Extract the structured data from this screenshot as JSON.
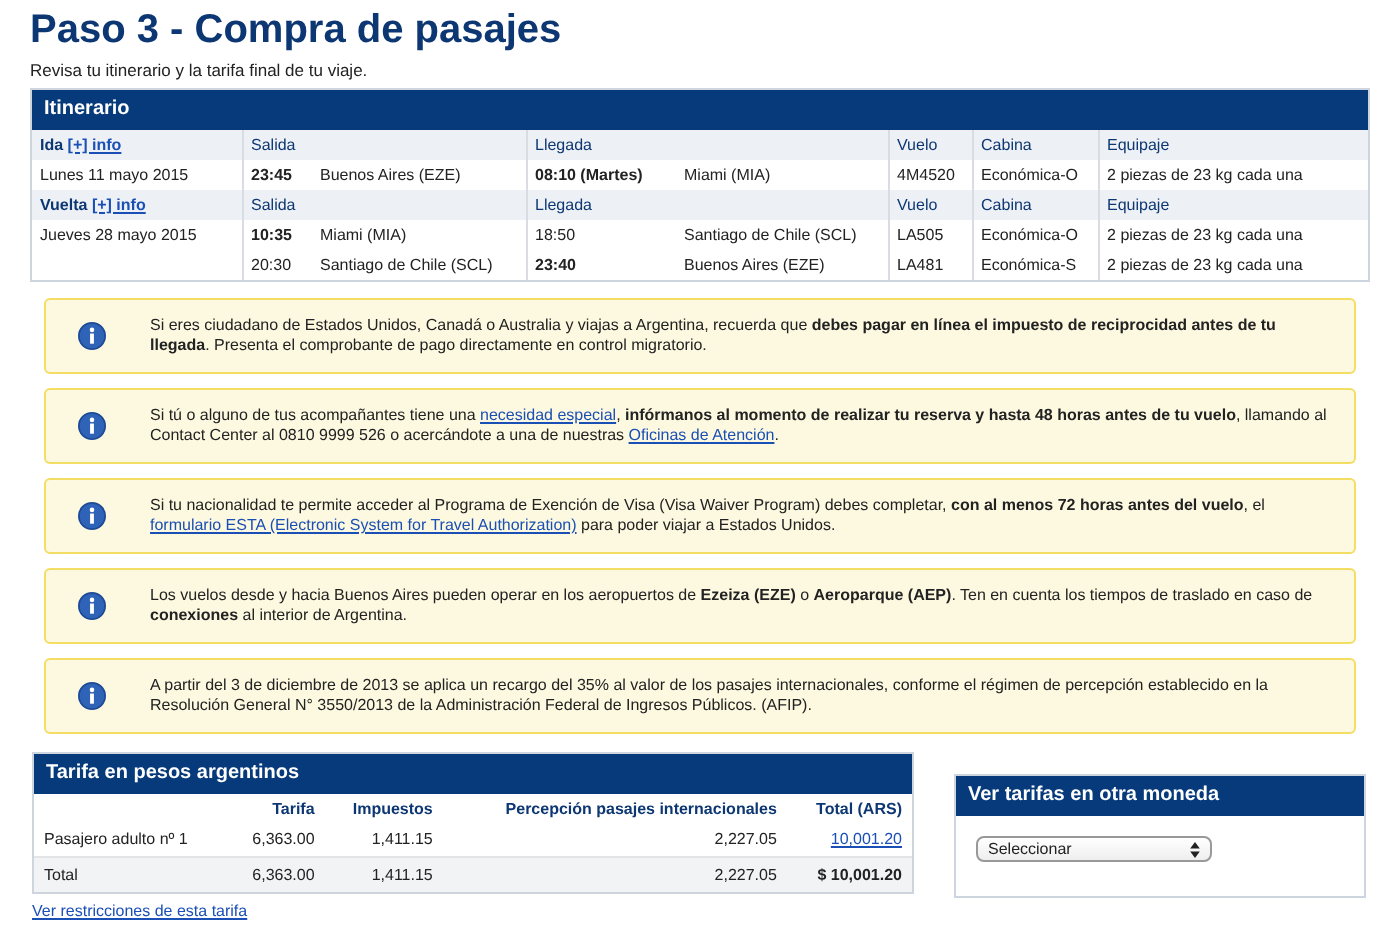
{
  "title": "Paso 3 - Compra de pasajes",
  "subtitle": "Revisa tu itinerario y la tarifa final de tu viaje.",
  "itinerary": {
    "title": "Itinerario",
    "segments": [
      {
        "label": "Ida",
        "link": "[+] info",
        "headers": {
          "departure": "Salida",
          "arrival": "Llegada",
          "flight": "Vuelo",
          "cabin": "Cabina",
          "baggage": "Equipaje"
        },
        "date": "Lunes 11 mayo 2015",
        "flights": [
          {
            "dep_time": "23:45",
            "dep_bold": true,
            "dep_city": "Buenos Aires (EZE)",
            "arr_time": "08:10 (Martes)",
            "arr_bold": true,
            "arr_city": "Miami (MIA)",
            "flight": "4M4520",
            "cabin": "Económica-O",
            "baggage": "2 piezas de 23 kg cada una"
          }
        ]
      },
      {
        "label": "Vuelta",
        "link": "[+] info",
        "headers": {
          "departure": "Salida",
          "arrival": "Llegada",
          "flight": "Vuelo",
          "cabin": "Cabina",
          "baggage": "Equipaje"
        },
        "date": "Jueves 28 mayo 2015",
        "flights": [
          {
            "dep_time": "10:35",
            "dep_bold": true,
            "dep_city": "Miami (MIA)",
            "arr_time": "18:50",
            "arr_bold": false,
            "arr_city": "Santiago de Chile (SCL)",
            "flight": "LA505",
            "cabin": "Económica-O",
            "baggage": "2 piezas de 23 kg cada una"
          },
          {
            "dep_time": "20:30",
            "dep_bold": false,
            "dep_city": "Santiago de Chile (SCL)",
            "arr_time": "23:40",
            "arr_bold": true,
            "arr_city": "Buenos Aires (EZE)",
            "flight": "LA481",
            "cabin": "Económica-S",
            "baggage": "2 piezas de 23 kg cada una"
          }
        ]
      }
    ]
  },
  "notices": [
    {
      "parts": [
        {
          "kind": "text",
          "text": "Si eres ciudadano de Estados Unidos, Canadá o Australia y viajas a Argentina, recuerda que **debes pagar en línea el impuesto de reciprocidad antes de tu llegada**. Presenta el comprobante de pago directamente en control migratorio."
        }
      ]
    },
    {
      "parts": [
        {
          "kind": "text",
          "text": "Si tú o alguno de tus acompañantes tiene una "
        },
        {
          "kind": "link",
          "text": "necesidad especial"
        },
        {
          "kind": "text",
          "text": ", **infórmanos al momento de realizar tu reserva y hasta 48 horas antes de tu vuelo**, llamando al Contact Center al 0810 9999 526 o acercándote a una de nuestras "
        },
        {
          "kind": "link",
          "text": "Oficinas de Atención"
        },
        {
          "kind": "text",
          "text": "."
        }
      ]
    },
    {
      "parts": [
        {
          "kind": "text",
          "text": "Si tu nacionalidad te permite acceder al Programa de Exención de Visa (Visa Waiver Program) debes completar, **con al menos 72 horas antes del vuelo**, el "
        },
        {
          "kind": "link",
          "text": "formulario ESTA (Electronic System  for Travel Authorization)"
        },
        {
          "kind": "text",
          "text": " para poder viajar a Estados Unidos."
        }
      ]
    },
    {
      "parts": [
        {
          "kind": "text",
          "text": "Los vuelos desde y hacia Buenos Aires pueden operar en los aeropuertos de **Ezeiza (EZE)** o **Aeroparque (AEP)**. Ten en cuenta los tiempos de traslado en caso de **conexiones** al interior de Argentina."
        }
      ]
    },
    {
      "parts": [
        {
          "kind": "text",
          "text": "A partir del 3 de diciembre de 2013 se aplica un recargo del 35% al valor de los pasajes internacionales, conforme el régimen de percepción establecido en la Resolución General N° 3550/2013 de la Administración Federal de Ingresos Públicos. (AFIP)."
        }
      ]
    }
  ],
  "fare": {
    "title": "Tarifa en pesos argentinos",
    "columns": [
      "Tarifa",
      "Impuestos",
      "Percepción pasajes internacionales",
      "Total (ARS)"
    ],
    "rows": [
      {
        "kind": "passenger",
        "label": "Pasajero adulto nº 1",
        "cells": [
          "6,363.00",
          "1,411.15",
          "2,227.05",
          "10,001.20"
        ]
      },
      {
        "kind": "total",
        "label": "Total",
        "cells": [
          "6,363.00",
          "1,411.15",
          "2,227.05",
          "$ 10,001.20"
        ]
      }
    ]
  },
  "currency": {
    "title": "Ver tarifas en otra moneda",
    "select": "Seleccionar"
  },
  "footer_link": "Ver restricciones de esta tarifa"
}
